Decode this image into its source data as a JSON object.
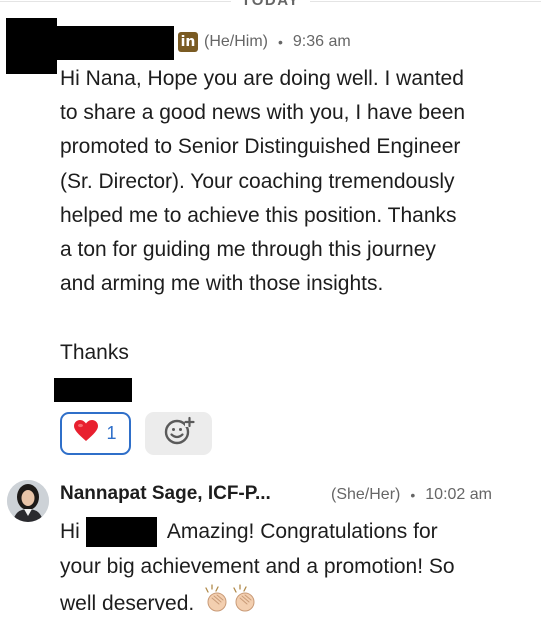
{
  "divider": {
    "label": "TODAY"
  },
  "message": {
    "pronouns": "(He/Him)",
    "separator": "•",
    "time": "9:36 am",
    "linkedin_icon": "linkedin-icon",
    "lines": [
      "Hi Nana, Hope you are doing well. I wanted",
      "to share a good news with you, I have been",
      "promoted to Senior Distinguished Engineer",
      "(Sr. Director). Your coaching tremendously",
      "helped me to achieve this position. Thanks",
      "a ton for guiding me through this journey",
      "and arming me with those insights."
    ],
    "closing": "Thanks"
  },
  "reactions": {
    "heart_count": "1",
    "heart_icon": "heart-icon",
    "add_icon": "add-reaction-icon"
  },
  "reply": {
    "name": "Nannapat Sage, ICF-P...",
    "pronouns": "(She/Her)",
    "separator": "•",
    "time": "10:02 am",
    "greeting": "Hi",
    "line1_rest": "Amazing! Congratulations for",
    "line2": "your big achievement and a promotion! So",
    "line3": "well deserved.",
    "clap_icon": "clapping-hands-icon"
  },
  "colors": {
    "accent_blue": "#2f6fc9",
    "linkedin_badge": "#7a5b23",
    "meta_gray": "#666666"
  }
}
